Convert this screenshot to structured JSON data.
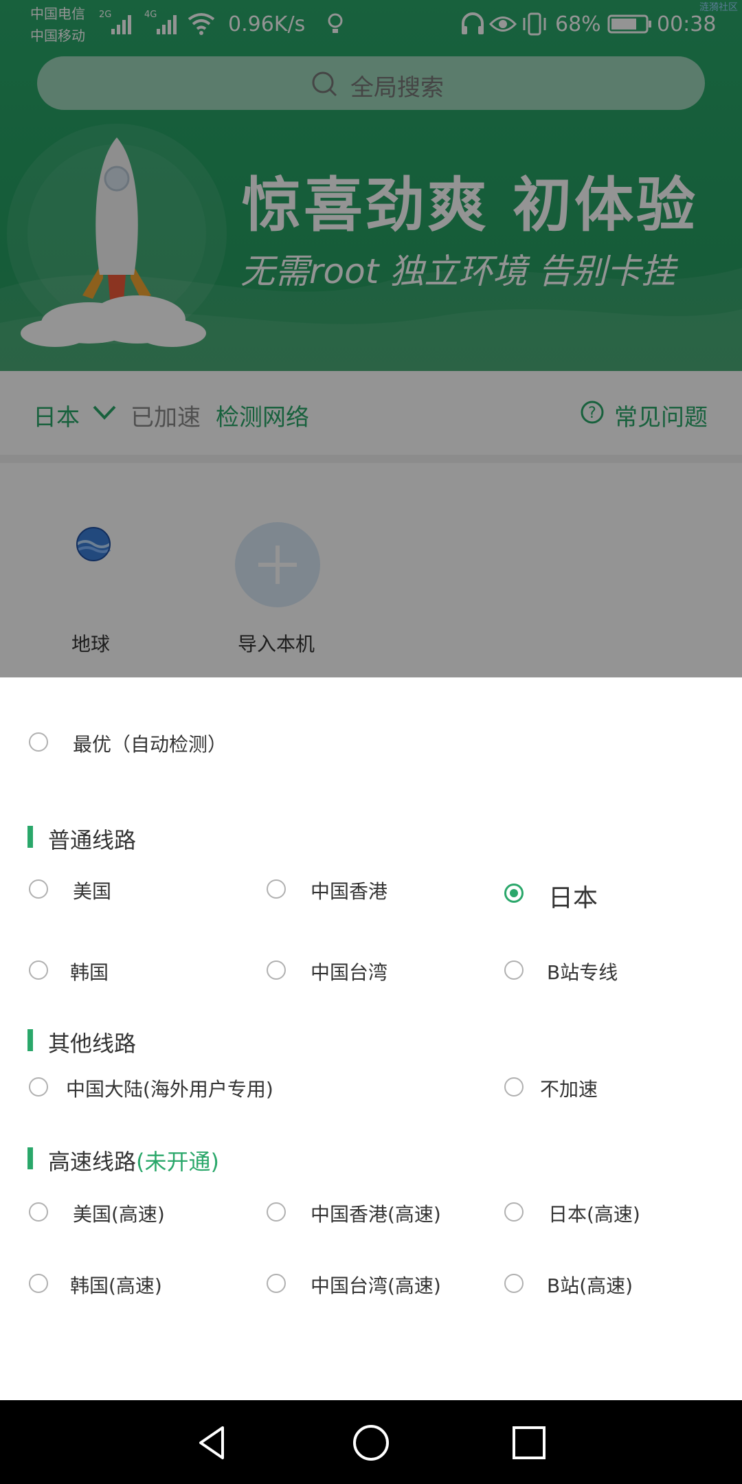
{
  "status_bar": {
    "carrier1": "中国电信",
    "carrier2": "中国移动",
    "net1": "2G",
    "net2": "4G",
    "speed": "0.96K/s",
    "battery": "68%",
    "time": "00:38"
  },
  "search": {
    "placeholder": "全局搜索"
  },
  "banner": {
    "title": "惊喜劲爽  初体验",
    "subtitle": "无需root  独立环境  告别卡挂",
    "watermark": "涟漪社区"
  },
  "network_bar": {
    "region": "日本",
    "status": "已加速",
    "detect": "检测网络",
    "faq": "常见问题"
  },
  "apps": [
    {
      "label": "地球"
    },
    {
      "label": "导入本机"
    }
  ],
  "sheet": {
    "best_option": "最优（自动检测）",
    "sections": [
      {
        "title": "普通线路",
        "options": [
          {
            "label": "美国",
            "selected": false
          },
          {
            "label": "中国香港",
            "selected": false
          },
          {
            "label": "日本",
            "selected": true
          },
          {
            "label": "韩国",
            "selected": false
          },
          {
            "label": "中国台湾",
            "selected": false
          },
          {
            "label": "B站专线",
            "selected": false
          }
        ]
      },
      {
        "title": "其他线路",
        "options": [
          {
            "label": "中国大陆(海外用户专用)",
            "selected": false
          },
          {
            "label": "不加速",
            "selected": false
          }
        ]
      },
      {
        "title": "高速线路",
        "title_note": "(未开通)",
        "options": [
          {
            "label": "美国(高速)",
            "selected": false
          },
          {
            "label": "中国香港(高速)",
            "selected": false
          },
          {
            "label": "日本(高速)",
            "selected": false
          },
          {
            "label": "韩国(高速)",
            "selected": false
          },
          {
            "label": "中国台湾(高速)",
            "selected": false
          },
          {
            "label": "B站(高速)",
            "selected": false
          }
        ]
      }
    ]
  },
  "colors": {
    "accent": "#2aa76a",
    "overlay": "rgba(0,0,0,0.42)"
  },
  "nav": {
    "back": "back-icon",
    "home": "home-icon",
    "recents": "recents-icon"
  }
}
